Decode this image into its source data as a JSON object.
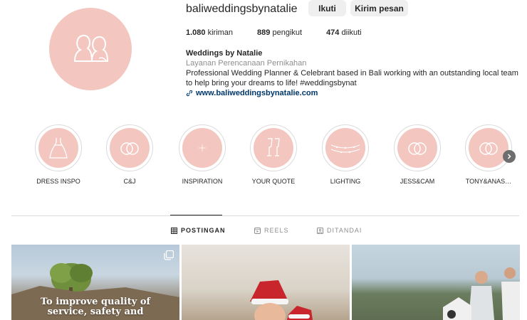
{
  "profile": {
    "username": "baliweddingsbynatalie",
    "follow_label": "Ikuti",
    "message_label": "Kirim pesan",
    "accent_color": "#f3c6c0"
  },
  "stats": {
    "posts_count": "1.080",
    "posts_label": "kiriman",
    "followers_count": "889",
    "followers_label": "pengikut",
    "following_count": "474",
    "following_label": "diikuti"
  },
  "bio": {
    "name": "Weddings by Natalie",
    "category": "Layanan Perencanaan Pernikahan",
    "description": "Professional Wedding Planner & Celebrant based in Bali working with an outstanding local team to help bring your dreams to life! #weddingsbynat",
    "link": "www.baliweddingsbynatalie.com"
  },
  "highlights": [
    {
      "label": "DRESS INSPO",
      "icon": "dress-icon"
    },
    {
      "label": "C&J",
      "icon": "rings-icon"
    },
    {
      "label": "INSPIRATION",
      "icon": "sparkle-icon"
    },
    {
      "label": "YOUR QUOTE",
      "icon": "champagne-icon"
    },
    {
      "label": "LIGHTING",
      "icon": "string-lights-icon"
    },
    {
      "label": "JESS&CAM",
      "icon": "rings-icon"
    },
    {
      "label": "TONY&ANAS…",
      "icon": "rings-icon"
    }
  ],
  "tabs": [
    {
      "label": "POSTINGAN",
      "icon": "grid-icon",
      "active": true
    },
    {
      "label": "REELS",
      "icon": "reels-icon",
      "active": false
    },
    {
      "label": "DITANDAI",
      "icon": "tagged-icon",
      "active": false
    }
  ],
  "posts": [
    {
      "overlay_text_line1": "To improve quality of",
      "overlay_text_line2": "service, safety and"
    },
    {
      "overlay_text_line1": "",
      "overlay_text_line2": ""
    },
    {
      "overlay_text_line1": "",
      "overlay_text_line2": ""
    }
  ]
}
